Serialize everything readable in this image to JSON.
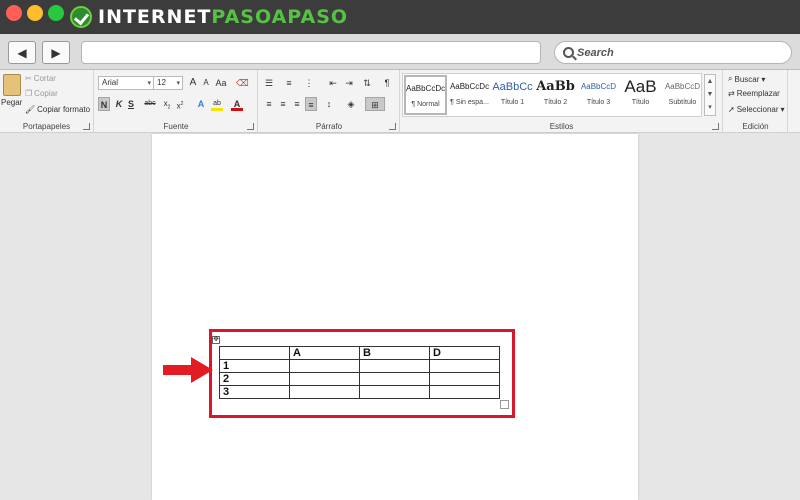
{
  "titlebar": {
    "logo_part1": "INTERNET",
    "logo_part2": "PASOAPASO",
    "controls": [
      "close",
      "minimize",
      "zoom"
    ]
  },
  "navbar": {
    "back_icon": "back-arrow-icon",
    "forward_icon": "forward-arrow-icon",
    "url": "",
    "search_placeholder": "Search"
  },
  "ribbon": {
    "clipboard": {
      "title": "Portapapeles",
      "paste": "Pegar",
      "cut": "Cortar",
      "copy": "Copiar",
      "format_painter": "Copiar formato"
    },
    "font": {
      "title": "Fuente",
      "family": "Arial",
      "size": "12",
      "grow": "A",
      "shrink": "A",
      "case": "Aa",
      "bold": "N",
      "italic": "K",
      "underline": "S",
      "strike": "abc",
      "subscript": "x",
      "superscript": "x",
      "text_effects": "A",
      "highlight": "ab",
      "font_color": "A"
    },
    "paragraph": {
      "title": "Párrafo",
      "pilcrow": "¶"
    },
    "styles": {
      "title": "Estilos",
      "items": [
        {
          "sample": "AaBbCcDc",
          "name": "¶ Normal"
        },
        {
          "sample": "AaBbCcDc",
          "name": "¶ Sin espa..."
        },
        {
          "sample": "AaBbCc",
          "name": "Título 1"
        },
        {
          "sample": "AaBb",
          "name": "Título 2"
        },
        {
          "sample": "AaBbCcD",
          "name": "Título 3"
        },
        {
          "sample": "AaB",
          "name": "Título"
        },
        {
          "sample": "AaBbCcD",
          "name": "Subtítulo"
        }
      ]
    },
    "editing": {
      "title": "Edición",
      "find": "Buscar",
      "replace": "Reemplazar",
      "select": "Seleccionar"
    }
  },
  "document": {
    "table": {
      "rows": [
        [
          "",
          "A",
          "B",
          "D"
        ],
        [
          "1",
          "",
          "",
          ""
        ],
        [
          "2",
          "",
          "",
          ""
        ],
        [
          "3",
          "",
          "",
          ""
        ]
      ]
    },
    "move_handle_glyph": "✥"
  },
  "colors": {
    "close": "#ff5f56",
    "minimize": "#ffbd2e",
    "zoom": "#27c93f",
    "highlight_border": "#d9172a",
    "arrow": "#e31b23"
  }
}
